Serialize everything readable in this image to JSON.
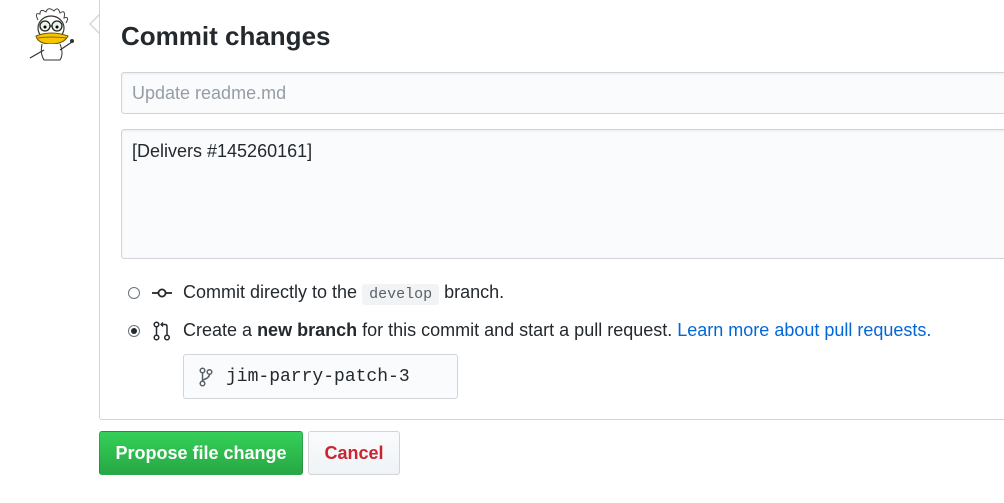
{
  "commit_form": {
    "title": "Commit changes",
    "summary_placeholder": "Update readme.md",
    "summary_value": "",
    "description_value": "[Delivers #145260161]"
  },
  "options": {
    "direct": {
      "selected": false,
      "text_before": "Commit directly to the",
      "branch": "develop",
      "text_after": "branch."
    },
    "new_branch": {
      "selected": true,
      "text_before": "Create a",
      "emphasis": "new branch",
      "text_after": "for this commit and start a pull request.",
      "link": "Learn more about pull requests."
    }
  },
  "branch_name": {
    "value": "jim-parry-patch-3"
  },
  "buttons": {
    "propose": "Propose file change",
    "cancel": "Cancel"
  },
  "icons": {
    "avatar": "cartoon-duck-avatar",
    "commit": "git-commit-icon",
    "pull_request": "git-pull-request-icon",
    "branch": "git-branch-icon"
  },
  "colors": {
    "primary": "#28a745",
    "link": "#0366d6",
    "danger": "#cb2431"
  }
}
